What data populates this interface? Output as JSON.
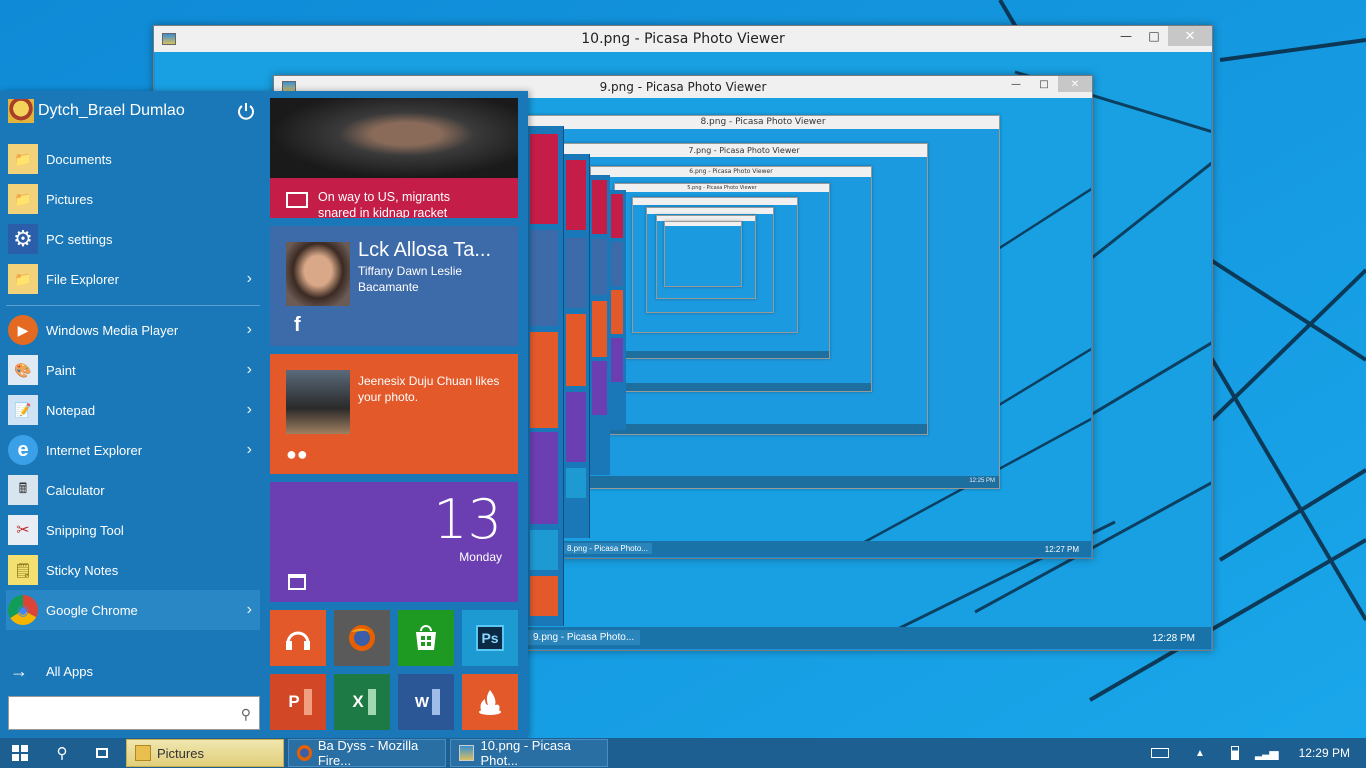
{
  "colors": {
    "desktop": "#1a9be0",
    "start_bg": "#1a78b8",
    "taskbar": "#1e5f91",
    "tile_red": "#c41e48",
    "tile_orange": "#e35929",
    "tile_purple": "#6b3fb2",
    "tile_facebook": "#3d6aa8"
  },
  "windows": {
    "w10": {
      "title": "10.png - Picasa Photo Viewer",
      "taskbar_btn": "9.png - Picasa Photo...",
      "time": "12:28 PM"
    },
    "w9": {
      "title": "9.png - Picasa Photo Viewer",
      "taskbar_btn": "8.png - Picasa Photo...",
      "time": "12:27 PM"
    },
    "w8": {
      "title": "8.png - Picasa Photo Viewer"
    },
    "w7": {
      "title": "7.png - Picasa Photo Viewer",
      "time": "12:25 PM"
    },
    "w6": {
      "title": "6.png - Picasa Photo Viewer"
    },
    "w5": {
      "title": "5.png - Picasa Photo Viewer"
    }
  },
  "start": {
    "user_name": "Dytch_Brael Dumlao",
    "power_icon": "power-icon",
    "items": [
      {
        "label": "Documents",
        "icon": "folder-icon",
        "arrow": false
      },
      {
        "label": "Pictures",
        "icon": "folder-icon",
        "arrow": false
      },
      {
        "label": "PC settings",
        "icon": "gear-icon",
        "arrow": false
      },
      {
        "label": "File Explorer",
        "icon": "folder-icon",
        "arrow": true
      },
      {
        "label": "Windows Media Player",
        "icon": "media-player-icon",
        "arrow": true
      },
      {
        "label": "Paint",
        "icon": "paint-icon",
        "arrow": true
      },
      {
        "label": "Notepad",
        "icon": "notepad-icon",
        "arrow": true
      },
      {
        "label": "Internet Explorer",
        "icon": "ie-icon",
        "arrow": true
      },
      {
        "label": "Calculator",
        "icon": "calculator-icon",
        "arrow": false
      },
      {
        "label": "Snipping Tool",
        "icon": "scissors-icon",
        "arrow": false
      },
      {
        "label": "Sticky Notes",
        "icon": "sticky-notes-icon",
        "arrow": false
      },
      {
        "label": "Google Chrome",
        "icon": "chrome-icon",
        "arrow": true
      }
    ],
    "all_apps": "All Apps",
    "search_placeholder": ""
  },
  "tiles": {
    "news": {
      "headline": "On way to US, migrants snared in kidnap racket"
    },
    "facebook": {
      "title": "Lck Allosa Ta...",
      "subtitle": "Tiffany Dawn Leslie Bacamante"
    },
    "people": {
      "text": "Jeenesix Duju Chuan likes your photo."
    },
    "calendar": {
      "day_number": "13",
      "day_name": "Monday"
    },
    "small": [
      {
        "name": "music-icon",
        "color": "#e35929"
      },
      {
        "name": "firefox-icon",
        "color": "#5a5a5a"
      },
      {
        "name": "store-icon",
        "color": "#1e9a23"
      },
      {
        "name": "photoshop-icon",
        "color": "#1e9ad3"
      },
      {
        "name": "powerpoint-icon",
        "color": "#d24726"
      },
      {
        "name": "excel-icon",
        "color": "#1e7a44"
      },
      {
        "name": "word-icon",
        "color": "#2b5797"
      },
      {
        "name": "flame-icon",
        "color": "#e35929"
      }
    ]
  },
  "taskbar": {
    "buttons": [
      {
        "label": "Pictures",
        "icon": "folder-icon",
        "active": true
      },
      {
        "label": "Ba Dyss - Mozilla Fire...",
        "icon": "firefox-icon",
        "active": false
      },
      {
        "label": "10.png - Picasa Phot...",
        "icon": "picasa-icon",
        "active": false
      }
    ],
    "time": "12:29 PM"
  }
}
